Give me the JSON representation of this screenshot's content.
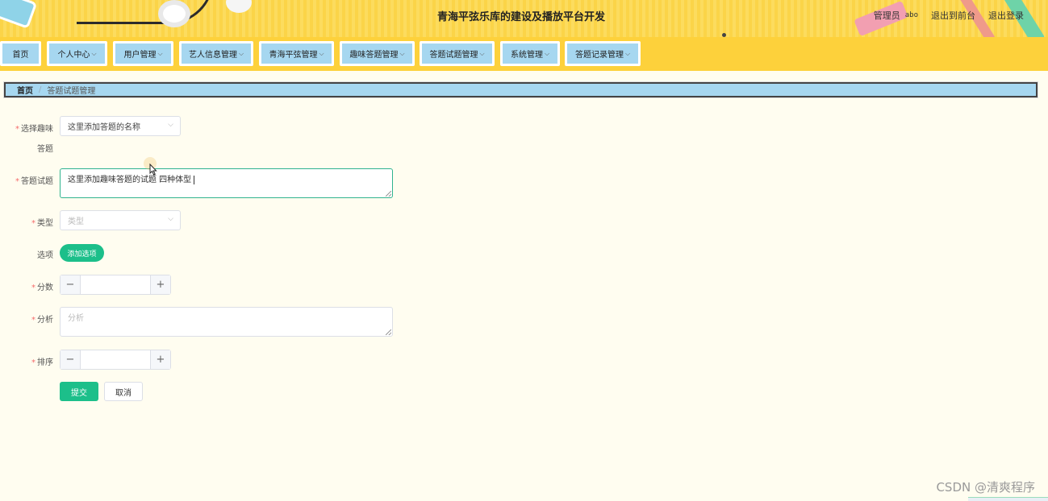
{
  "header": {
    "title": "青海平弦乐库的建设及播放平台开发",
    "admin_role": "管理员",
    "admin_name": "abo",
    "to_front": "退出到前台",
    "logout": "退出登录"
  },
  "nav": {
    "items": [
      {
        "label": "首页",
        "has_dropdown": false
      },
      {
        "label": "个人中心",
        "has_dropdown": true
      },
      {
        "label": "用户管理",
        "has_dropdown": true
      },
      {
        "label": "艺人信息管理",
        "has_dropdown": true
      },
      {
        "label": "青海平弦管理",
        "has_dropdown": true
      },
      {
        "label": "趣味答题管理",
        "has_dropdown": true
      },
      {
        "label": "答题试题管理",
        "has_dropdown": true
      },
      {
        "label": "系统管理",
        "has_dropdown": true
      },
      {
        "label": "答题记录管理",
        "has_dropdown": true
      }
    ]
  },
  "breadcrumb": {
    "home": "首页",
    "separator": "/",
    "current": "答题试题管理"
  },
  "form": {
    "quiz_label_line1": "选择趣味",
    "quiz_label_line2": "答题",
    "quiz_value": "这里添加答题的名称",
    "question_label": "答题试题",
    "question_value": "这里添加趣味答题的试题 四种体型",
    "type_label": "类型",
    "type_placeholder": "类型",
    "options_label": "选项",
    "add_option": "添加选项",
    "score_label": "分数",
    "analysis_label": "分析",
    "analysis_placeholder": "分析",
    "sort_label": "排序",
    "required_mark": "*",
    "minus": "−",
    "plus": "+",
    "submit": "提交",
    "cancel": "取消"
  },
  "watermark": "CSDN @清爽程序",
  "colors": {
    "header_yellow": "#fbd448",
    "nav_button": "#a6d7f0",
    "primary_green": "#1cbf8a",
    "required_red": "#f56c6c",
    "page_bg": "#fffdf0"
  }
}
